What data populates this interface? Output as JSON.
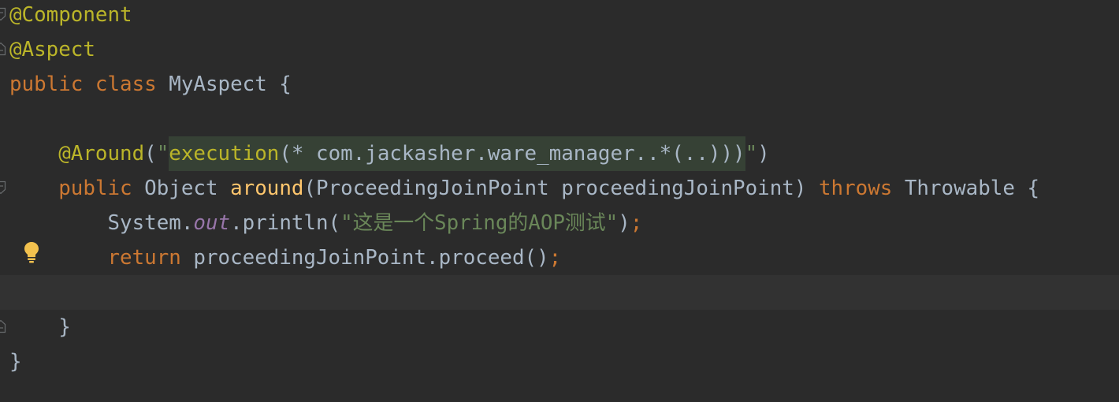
{
  "colors": {
    "background": "#2b2b2b",
    "current_line": "#323232",
    "plain": "#a9b7c6",
    "keyword": "#cc7832",
    "annotation": "#bbb529",
    "string": "#6a8759",
    "method_declaration": "#ffc66d",
    "static_field": "#9876aa",
    "injected_keyword": "#bbb529",
    "injected_background": "#364135",
    "fold_marker": "#696c6e",
    "bulb": "#f2c14e"
  },
  "editor": {
    "lines": [
      {
        "gutter_icon": "fold-start-icon",
        "tokens": [
          {
            "text": "@Component",
            "kind": "annotation"
          }
        ]
      },
      {
        "gutter_icon": "fold-end-icon",
        "tokens": [
          {
            "text": "@Aspect",
            "kind": "annotation"
          }
        ]
      },
      {
        "tokens": [
          {
            "text": "public",
            "kind": "keyword"
          },
          {
            "text": " ",
            "kind": "plain"
          },
          {
            "text": "class",
            "kind": "keyword"
          },
          {
            "text": " MyAspect {",
            "kind": "plain"
          }
        ]
      },
      {
        "tokens": []
      },
      {
        "tokens": [
          {
            "text": "    ",
            "kind": "plain"
          },
          {
            "text": "@Around",
            "kind": "annotation"
          },
          {
            "text": "(",
            "kind": "plain"
          },
          {
            "text": "\"",
            "kind": "string"
          },
          {
            "text": "execution",
            "kind": "injected_keyword"
          },
          {
            "text": "(* com.jackasher.ware_manager..*(..)))",
            "kind": "injected"
          },
          {
            "text": "\"",
            "kind": "string"
          },
          {
            "text": ")",
            "kind": "plain"
          }
        ]
      },
      {
        "gutter_icon": "fold-start-icon",
        "tokens": [
          {
            "text": "    ",
            "kind": "plain"
          },
          {
            "text": "public",
            "kind": "keyword"
          },
          {
            "text": " Object ",
            "kind": "plain"
          },
          {
            "text": "around",
            "kind": "method_declaration"
          },
          {
            "text": "(ProceedingJoinPoint proceedingJoinPoint) ",
            "kind": "plain"
          },
          {
            "text": "throws",
            "kind": "keyword"
          },
          {
            "text": " Throwable {",
            "kind": "plain"
          }
        ]
      },
      {
        "tokens": [
          {
            "text": "        System.",
            "kind": "plain"
          },
          {
            "text": "out",
            "kind": "static_field"
          },
          {
            "text": ".println(",
            "kind": "plain"
          },
          {
            "text": "\"这是一个Spring的AOP测试\"",
            "kind": "string"
          },
          {
            "text": ")",
            "kind": "plain"
          },
          {
            "text": ";",
            "kind": "keyword"
          }
        ]
      },
      {
        "gutter_icon": "intention-bulb-icon",
        "tokens": [
          {
            "text": "        ",
            "kind": "plain"
          },
          {
            "text": "return",
            "kind": "keyword"
          },
          {
            "text": " proceedingJoinPoint.proceed()",
            "kind": "plain"
          },
          {
            "text": ";",
            "kind": "keyword"
          }
        ]
      },
      {
        "current": true,
        "tokens": []
      },
      {
        "gutter_icon": "fold-end-icon",
        "tokens": [
          {
            "text": "    }",
            "kind": "plain"
          }
        ]
      },
      {
        "tokens": [
          {
            "text": "}",
            "kind": "plain"
          }
        ]
      }
    ]
  }
}
